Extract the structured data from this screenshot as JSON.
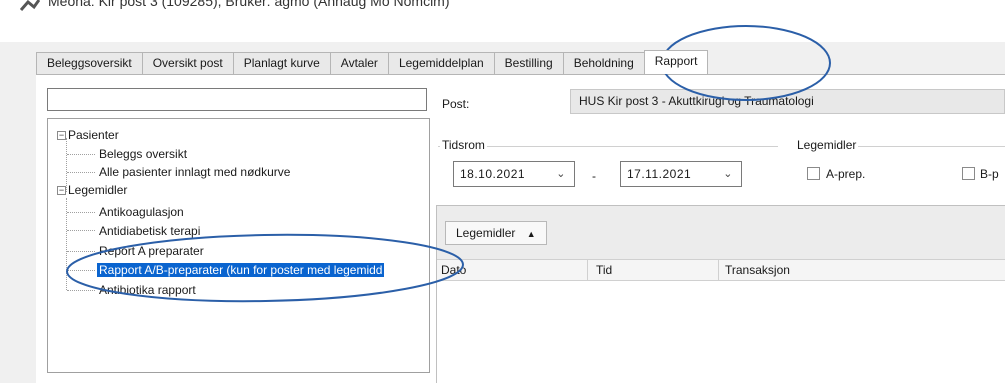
{
  "window": {
    "title": "Meona: Kir post 3 (109285), Bruker: agmo (Annaug Mo Nomcim)"
  },
  "tabs": [
    {
      "label": "Beleggsoversikt"
    },
    {
      "label": "Oversikt post"
    },
    {
      "label": "Planlagt kurve"
    },
    {
      "label": "Avtaler"
    },
    {
      "label": "Legemiddelplan"
    },
    {
      "label": "Bestilling"
    },
    {
      "label": "Beholdning"
    },
    {
      "label": "Rapport"
    }
  ],
  "active_tab": "Rapport",
  "search": {
    "value": ""
  },
  "tree": {
    "pasienter": {
      "label": "Pasienter",
      "children": [
        "Beleggs oversikt",
        "Alle pasienter innlagt med nødkurve"
      ]
    },
    "legemidler": {
      "label": "Legemidler",
      "children": [
        "Antikoagulasjon",
        "Antidiabetisk terapi",
        "Report A preparater",
        "Rapport A/B-preparater (kun for poster med legemidd",
        "Antibiotika rapport"
      ]
    },
    "selected_index": 3
  },
  "post": {
    "label": "Post:",
    "value": "HUS Kir post 3 - Akuttkirugi og Traumatologi"
  },
  "tidsrom": {
    "label": "Tidsrom",
    "from": "18.10.2021",
    "separator": "-",
    "to": "17.11.2021"
  },
  "legemidler_filter": {
    "label": "Legemidler",
    "a_prep": "A-prep.",
    "b_prep": "B-p"
  },
  "grid": {
    "group_button": "Legemidler",
    "columns": [
      "Dato",
      "Tid",
      "Transaksjon"
    ]
  },
  "colors": {
    "annotation": "#2b5fa8",
    "selection": "#0a64cf"
  }
}
